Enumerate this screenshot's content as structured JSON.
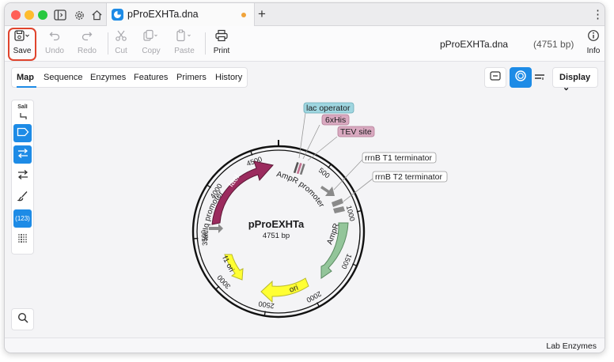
{
  "window": {
    "tab_title": "pProEXHTa.dna",
    "new_tab": "+",
    "more": "⋮"
  },
  "toolbar": {
    "save": "Save",
    "undo": "Undo",
    "redo": "Redo",
    "cut": "Cut",
    "copy": "Copy",
    "paste": "Paste",
    "print": "Print",
    "info": "Info",
    "filename": "pProEXHTa.dna",
    "length": "(4751 bp)"
  },
  "nav_tabs": [
    "Map",
    "Sequence",
    "Enzymes",
    "Features",
    "Primers",
    "History"
  ],
  "view": {
    "display_label": "Display",
    "chevron": "⌄"
  },
  "tools": {
    "sall": "SalI",
    "numbers": "(123)"
  },
  "map": {
    "name": "pProEXHTa",
    "length_label": "4751 bp",
    "ticks": [
      "500",
      "1000",
      "1500",
      "2000",
      "2500",
      "3000",
      "3500",
      "4000",
      "4500"
    ],
    "features": {
      "lacI": "lacI",
      "AmpR": "AmpR",
      "ori": "ori",
      "f1_ori": "f1 ori",
      "ampr_promoter": "AmpR promoter",
      "laciq_promoter": "lacIq promoter"
    },
    "callouts": {
      "lac_operator": "lac operator",
      "his": "6xHis",
      "tev": "TEV site",
      "t1": "rrnB T1 terminator",
      "t2": "rrnB T2 terminator"
    },
    "colors": {
      "lacI": "#9b2b5e",
      "AmpR": "#93c59a",
      "ori": "#ffff33",
      "f1_ori": "#ffff33",
      "promoter": "#8a8a8a",
      "lac_operator": "#9fd6e0",
      "his": "#d9a9c0",
      "tev": "#d9a9c0"
    }
  },
  "status": {
    "enzymes": "Lab Enzymes"
  },
  "accent": "#1d8be6",
  "highlight": "#e0442d"
}
